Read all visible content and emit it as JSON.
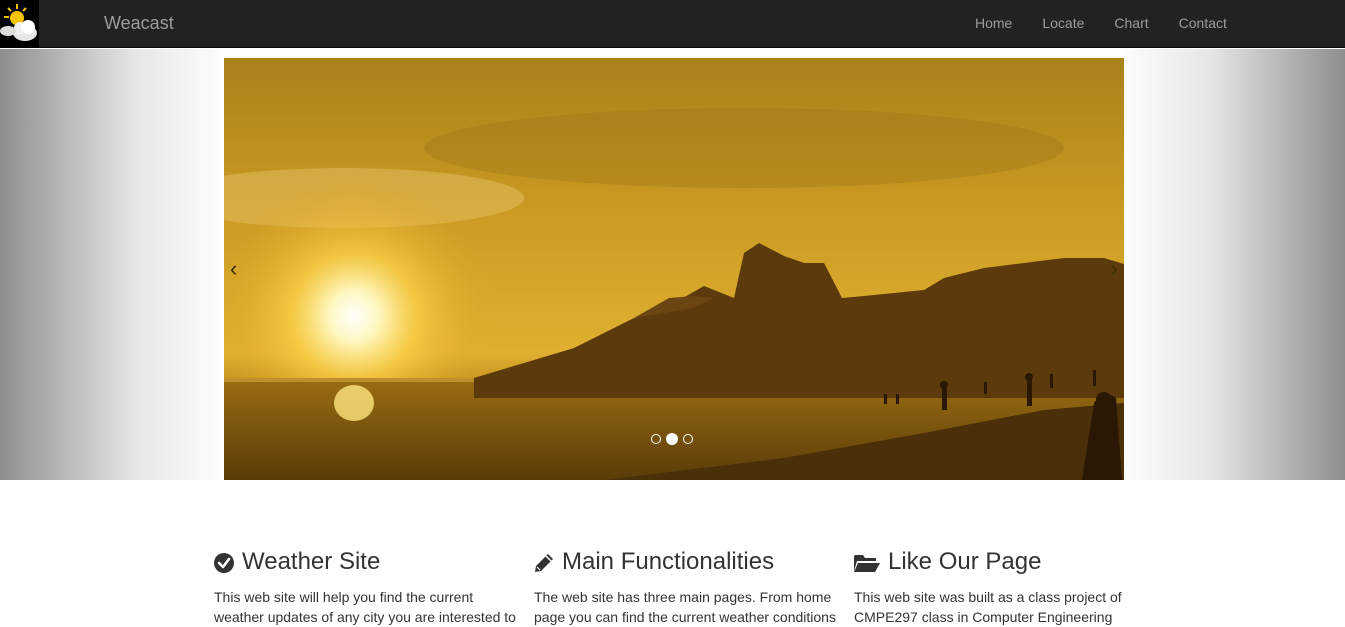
{
  "navbar": {
    "logo_icon": "sun-cloud-icon",
    "brand": "Weacast",
    "links": [
      {
        "label": "Home"
      },
      {
        "label": "Locate"
      },
      {
        "label": "Chart"
      },
      {
        "label": "Contact"
      }
    ]
  },
  "carousel": {
    "image": "sunset-beach-photo",
    "prev_label": "‹",
    "next_label": "›",
    "slide_count": 3,
    "active_slide": 2
  },
  "features": [
    {
      "icon": "check-circle-icon",
      "title": "Weather Site",
      "text": "This web site will help you find the current weather updates of any city you are interested to"
    },
    {
      "icon": "pencil-icon",
      "title": "Main Functionalities",
      "text": "The web site has three main pages. From home page you can find the current weather conditions"
    },
    {
      "icon": "folder-open-icon",
      "title": "Like Our Page",
      "text": "This web site was built as a class project of CMPE297 class in Computer Engineering"
    }
  ],
  "colors": {
    "navbar_bg": "#222222",
    "nav_text": "#9d9d9d",
    "body_text": "#333333"
  }
}
